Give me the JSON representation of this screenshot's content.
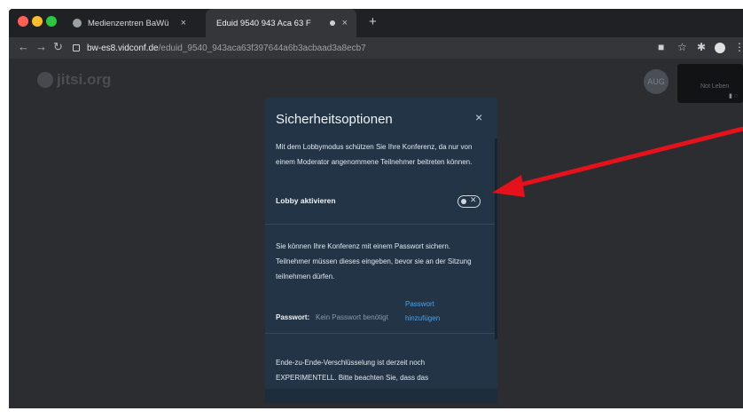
{
  "browser": {
    "tabs": [
      {
        "label": "Medienzentren BaWü",
        "close": "×"
      },
      {
        "label": "Eduid 9540 943 Aca 63 F",
        "close": "×"
      }
    ],
    "new_tab": "+",
    "url_host": "bw-es8.vidconf.de",
    "url_path": "/eduid_9540_943aca63f397644a6b3acbaad3a8ecb7"
  },
  "app": {
    "logo_text": "jitsi.org",
    "avatar_text": "AUG",
    "thumbnail_text": "Not Leben"
  },
  "dialog": {
    "title": "Sicherheitsoptionen",
    "close": "×",
    "lobby_description": "Mit dem Lobbymodus schützen Sie Ihre Konferenz, da nur von einem Moderator angenommene Teilnehmer beitreten können.",
    "lobby_label": "Lobby aktivieren",
    "lobby_enabled": false,
    "password_description": "Sie können Ihre Konferenz mit einem Passwort sichern. Teilnehmer müssen dieses eingeben, bevor sie an der Sitzung teilnehmen dürfen.",
    "password_label": "Passwort:",
    "password_value": "Kein Passwort benötigt",
    "password_link": "Passwort hinzufügen",
    "e2ee_description": "Ende-zu-Ende-Verschlüsselung ist derzeit noch EXPERIMENTELL. Bitte beachten Sie, dass das"
  },
  "annotation": {
    "color": "#e5121b"
  },
  "colors": {
    "link": "#4fa3e8",
    "dialog_bg": "#223446"
  }
}
